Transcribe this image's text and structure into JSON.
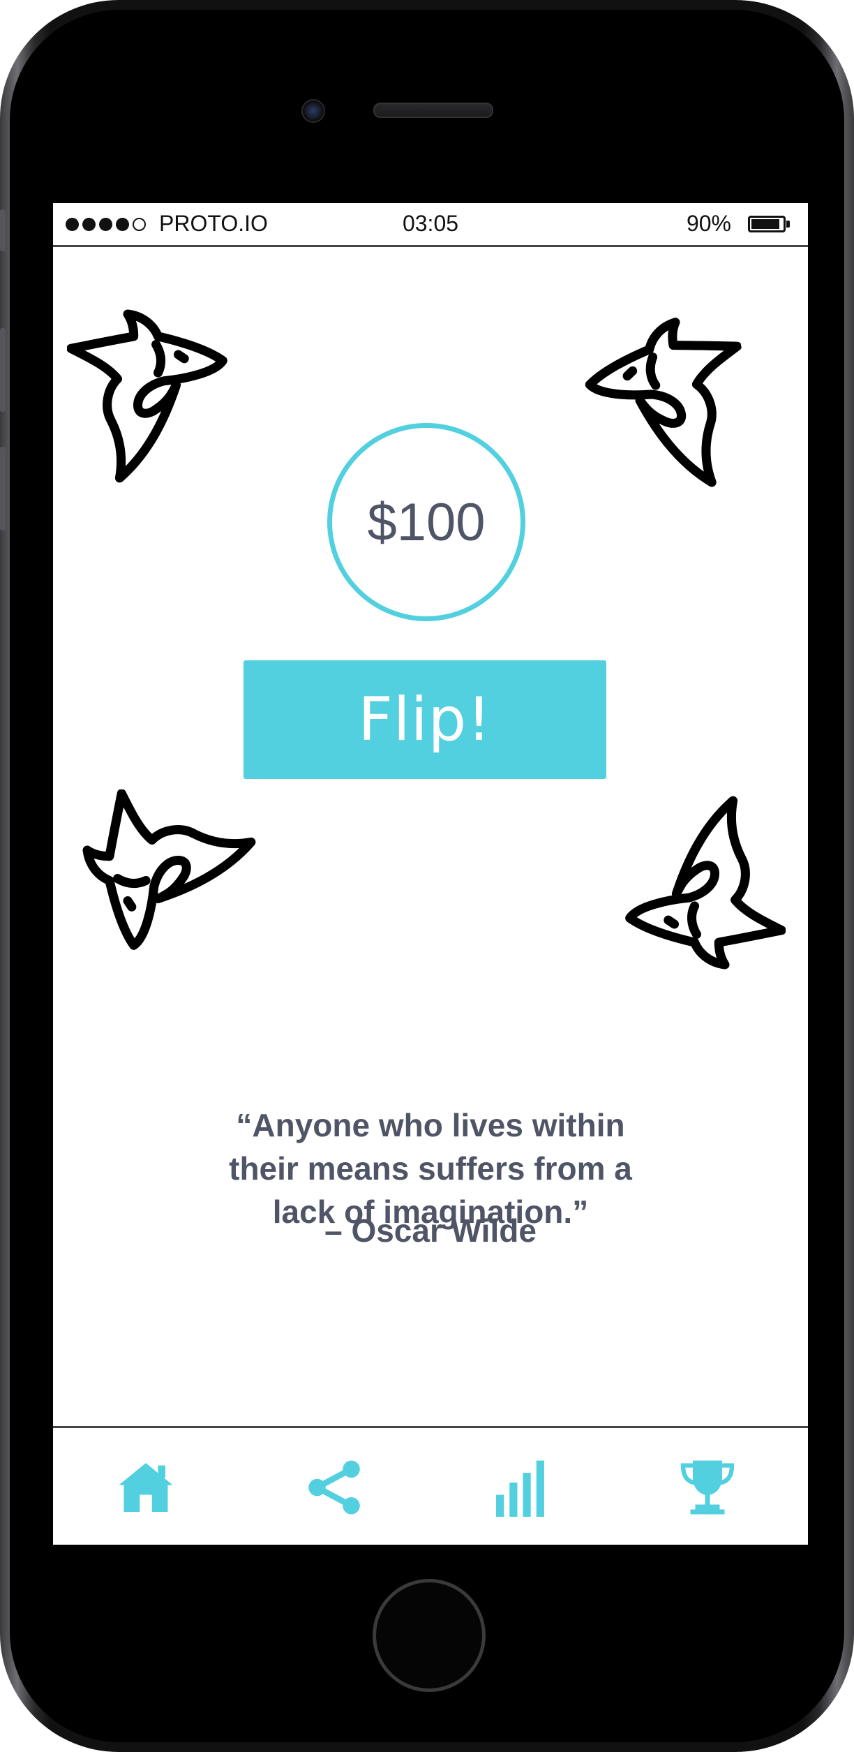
{
  "status_bar": {
    "carrier": "PROTO.IO",
    "time": "03:05",
    "battery": "90%",
    "battery_level": 0.9,
    "signal_bars_filled": 4,
    "signal_bars_total": 5
  },
  "balance": "$100",
  "flip_button_label": "Flip!",
  "quote": {
    "line1": "“Anyone who lives within",
    "line2": "their means suffers from a",
    "line3": "lack of imagination.”",
    "author": "– Oscar Wilde"
  },
  "tabs": [
    {
      "icon": "home-icon"
    },
    {
      "icon": "share-icon"
    },
    {
      "icon": "bar-chart-icon"
    },
    {
      "icon": "trophy-icon"
    }
  ],
  "colors": {
    "accent": "#52d0df",
    "text": "#4f5566"
  }
}
